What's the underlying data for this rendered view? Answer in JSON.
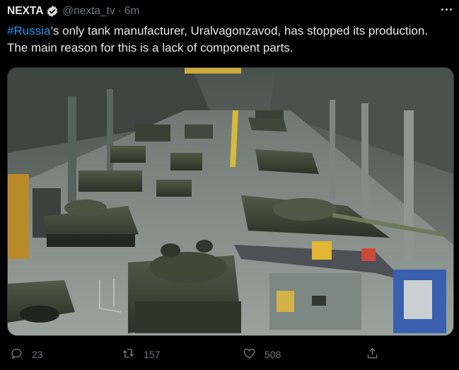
{
  "tweet": {
    "display_name": "NEXTA",
    "handle": "@nexta_tv",
    "separator": "·",
    "time": "6m",
    "hashtag": "#Russia",
    "text_rest": "’s only tank manufacturer, Uralvagonzavod, has stopped its production. The main reason for this is a lack of component parts."
  },
  "actions": {
    "replies": "23",
    "retweets": "157",
    "likes": "508"
  },
  "colors": {
    "background": "#000000",
    "text": "#e7e9ea",
    "muted": "#71767b",
    "link": "#1d9bf0"
  },
  "icons": [
    "verified-badge-icon",
    "more-options-icon",
    "reply-icon",
    "retweet-icon",
    "like-icon",
    "share-icon"
  ]
}
